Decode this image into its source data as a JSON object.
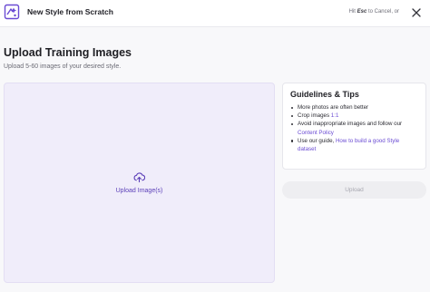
{
  "header": {
    "title": "New Style from Scratch",
    "hint_prefix": "Hit",
    "hint_key": "Esc",
    "hint_suffix": "to Cancel, or",
    "logo_icon": "style-logo-icon",
    "close_icon": "close-icon"
  },
  "main": {
    "title": "Upload Training Images",
    "subtitle": "Upload 5-60 images of your desired style.",
    "dropzone": {
      "icon": "upload-cloud-icon",
      "label": "Upload Image(s)"
    }
  },
  "guidelines": {
    "title": "Guidelines & Tips",
    "tip1": "More photos are often better",
    "tip2_prefix": "Crop images ",
    "tip2_link": "1:1",
    "tip3_prefix": "Avoid inappropriate images and follow our ",
    "tip3_link": "Content Policy",
    "tip4_prefix": "Use our guide, ",
    "tip4_link": "How to build a good Style dataset"
  },
  "actions": {
    "upload_button": "Upload"
  },
  "colors": {
    "accent": "#6a4bd3",
    "dropzone_bg": "#f0edfa",
    "disabled_button_bg": "#eeeef1"
  }
}
